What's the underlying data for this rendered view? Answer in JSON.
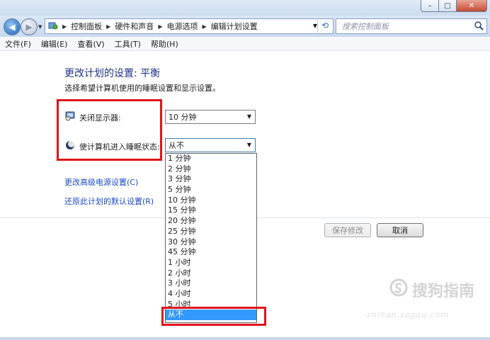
{
  "window": {
    "caption_min": "–",
    "caption_max": "□",
    "caption_close": "✕"
  },
  "addressbar": {
    "breadcrumbs": [
      "控制面板",
      "硬件和声音",
      "电源选项",
      "编辑计划设置"
    ],
    "search_placeholder": "搜索控制面板"
  },
  "menu": [
    "文件(F)",
    "编辑(E)",
    "查看(V)",
    "工具(T)",
    "帮助(H)"
  ],
  "content": {
    "title": "更改计划的设置: 平衡",
    "subtitle": "选择希望计算机使用的睡眠设置和显示设置。",
    "display_label": "关闭显示器:",
    "display_value": "10 分钟",
    "sleep_label": "使计算机进入睡眠状态:",
    "sleep_value": "从不",
    "link_advanced": "更改高级电源设置(C)",
    "link_restore": "还原此计划的默认设置(R)",
    "save_button": "保存修改",
    "cancel_button": "取消"
  },
  "sleep_options": [
    "1 分钟",
    "2 分钟",
    "3 分钟",
    "5 分钟",
    "10 分钟",
    "15 分钟",
    "20 分钟",
    "25 分钟",
    "30 分钟",
    "45 分钟",
    "1 小时",
    "2 小时",
    "3 小时",
    "4 小时",
    "5 小时",
    "从不"
  ],
  "sleep_selected_index": 15,
  "watermark": {
    "brand": "搜狗指南",
    "url": "zhinan.sogou.com"
  },
  "colors": {
    "highlight": "#e0141b",
    "selection": "#3399ff",
    "heading": "#1e3287",
    "link": "#1a4ac4"
  }
}
